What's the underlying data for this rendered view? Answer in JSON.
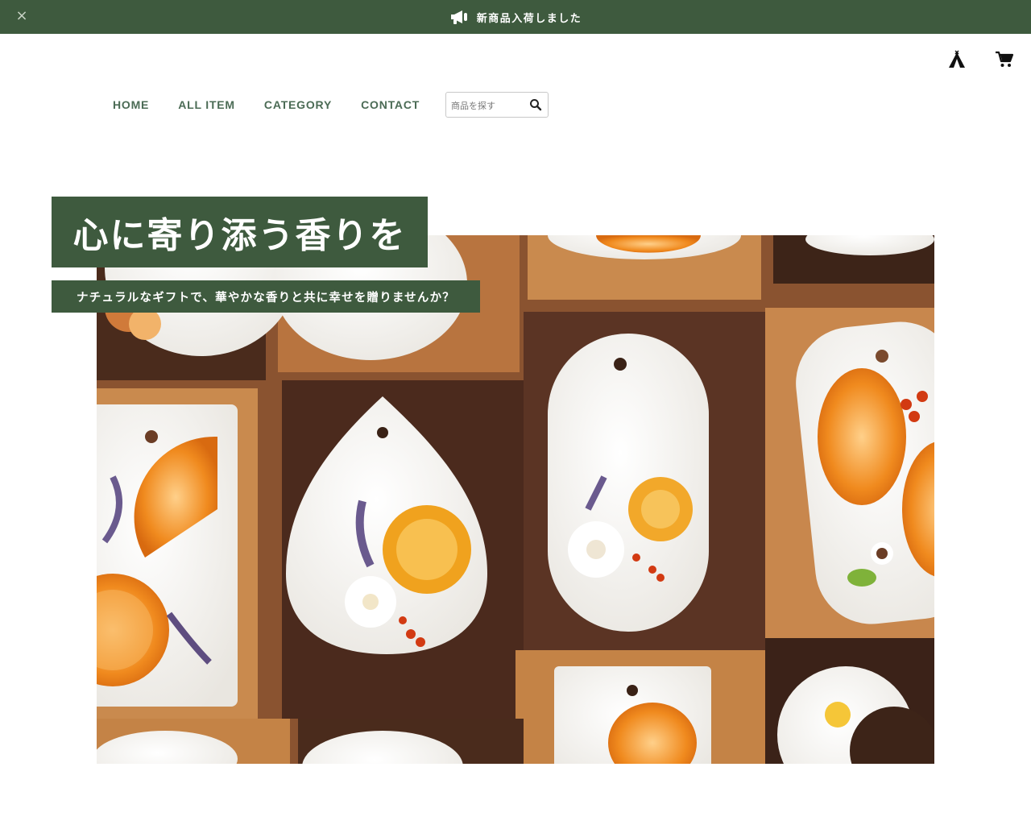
{
  "announcement": {
    "text": "新商品入荷しました",
    "close_symbol": "×",
    "icon": "megaphone-icon"
  },
  "header": {
    "icons": [
      "tent-icon",
      "cart-icon"
    ]
  },
  "nav": {
    "items": [
      {
        "label": "HOME"
      },
      {
        "label": "ALL ITEM"
      },
      {
        "label": "CATEGORY"
      },
      {
        "label": "CONTACT"
      }
    ],
    "search": {
      "placeholder": "商品を探す",
      "value": "",
      "icon": "search-icon"
    }
  },
  "hero": {
    "headline": "心に寄り添う香りを",
    "subline": "ナチュラルなギフトで、華やかな香りと共に幸せを贈りませんか？",
    "image_description": ""
  },
  "colors": {
    "brand_green": "#3e5a3e",
    "nav_text": "#4b6b55",
    "white": "#ffffff"
  }
}
